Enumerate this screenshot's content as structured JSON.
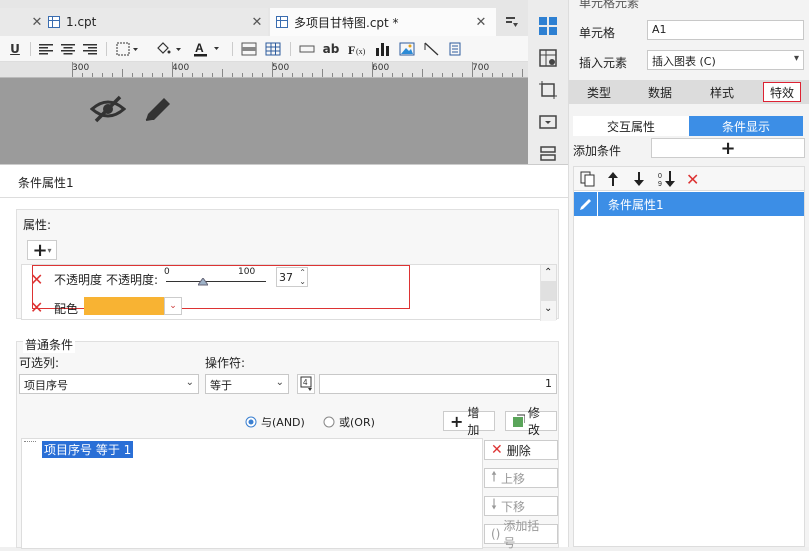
{
  "tabs": [
    {
      "label": "1.cpt",
      "active": false
    },
    {
      "label": "多项目甘特图.cpt *",
      "active": true
    }
  ],
  "ruler": {
    "labels": [
      "300",
      "400",
      "500",
      "600",
      "700"
    ]
  },
  "right_panel": {
    "title_partial": "单元格元素",
    "cell_label": "单元格",
    "cell_value": "A1",
    "insert_label": "插入元素",
    "insert_value": "插入图表 (C)",
    "tabs": [
      "类型",
      "数据",
      "样式",
      "特效"
    ],
    "active_tab": "特效",
    "subtabs": [
      "交互属性",
      "条件显示"
    ],
    "active_subtab": "条件显示",
    "add_condition_label": "添加条件",
    "add_symbol": "+",
    "condition_item": "条件属性1"
  },
  "dialog": {
    "title": "条件属性1",
    "attributes_label": "属性:",
    "add_symbol": "+",
    "opacity_label": "不透明度",
    "opacity_label2": "不透明度:",
    "slider_min": "0",
    "slider_max": "100",
    "opacity_value": "37",
    "color_label": "配色",
    "colors": {
      "color_swatch": "#f8b333",
      "accent": "#3c8ee6",
      "highlight": "#2a6fd6",
      "error": "#d33"
    },
    "normal_conditions_label": "普通条件",
    "column_label": "可选列:",
    "column_value": "项目序号",
    "operator_label": "操作符:",
    "operator_value": "等于",
    "value_input": "1",
    "and_label": "与(AND)",
    "or_label": "或(OR)",
    "add_btn": "增加",
    "modify_btn": "修改",
    "condition_line": "项目序号 等于 1",
    "delete_btn": "删除",
    "up_btn": "上移",
    "down_btn": "下移",
    "bracket_btn": "添加括号"
  }
}
